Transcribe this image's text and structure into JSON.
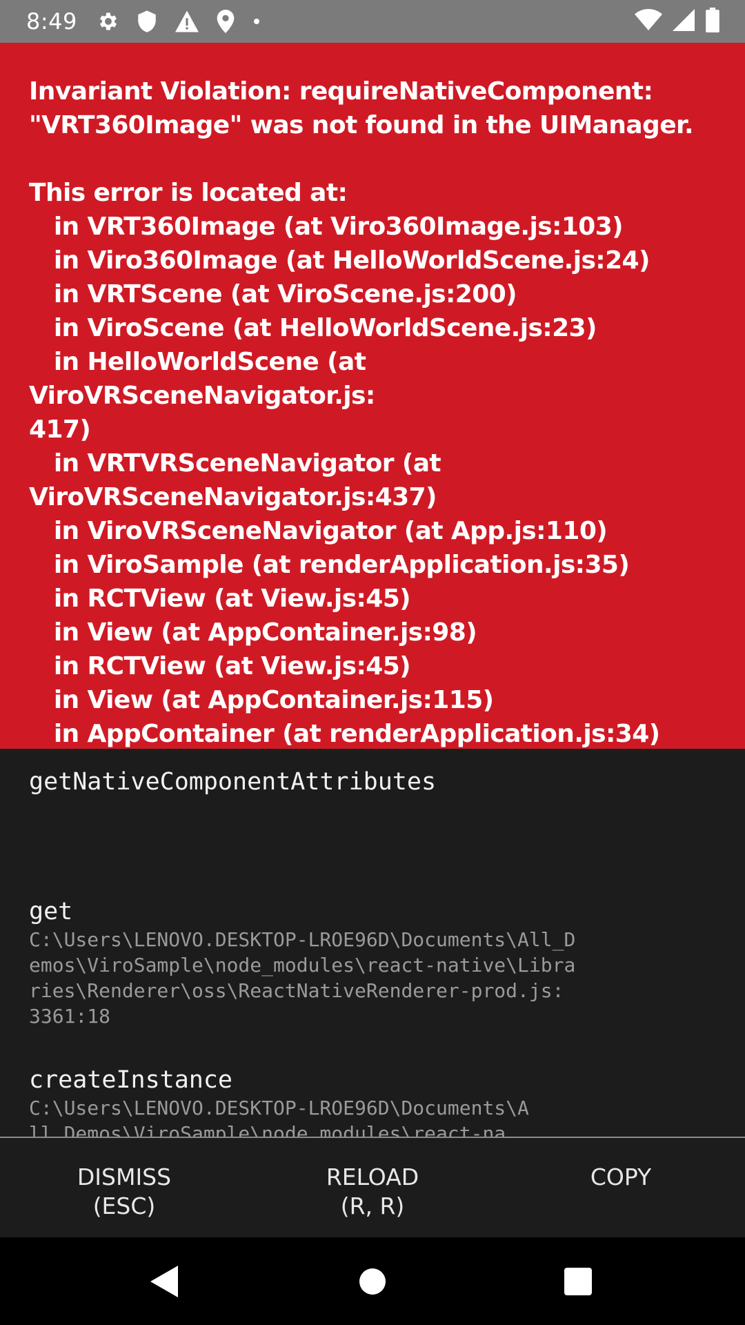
{
  "status_bar": {
    "time": "8:49",
    "icons": [
      "gear-icon",
      "shield-icon",
      "warning-icon",
      "location-pin-icon",
      "dot-icon"
    ],
    "right_icons": [
      "wifi-icon",
      "signal-icon",
      "battery-icon"
    ]
  },
  "error": {
    "title": "Invariant Violation: requireNativeComponent:\n\"VRT360Image\" was not found in the UIManager.",
    "located_header": "This error is located at:",
    "stack_lines": [
      "   in VRT360Image (at Viro360Image.js:103)",
      "   in Viro360Image (at HelloWorldScene.js:24)",
      "   in VRTScene (at ViroScene.js:200)",
      "   in ViroScene (at HelloWorldScene.js:23)",
      "   in HelloWorldScene (at ViroVRSceneNavigator.js:\n417)",
      "   in VRTVRSceneNavigator (at\nViroVRSceneNavigator.js:437)",
      "   in ViroVRSceneNavigator (at App.js:110)",
      "   in ViroSample (at renderApplication.js:35)",
      "   in RCTView (at View.js:45)",
      "   in View (at AppContainer.js:98)",
      "   in RCTView (at View.js:45)",
      "   in View (at AppContainer.js:115)",
      "   in AppContainer (at renderApplication.js:34)"
    ]
  },
  "stack_frames": [
    {
      "method": "getNativeComponentAttributes",
      "location": ""
    },
    {
      "method": "get",
      "location": "C:\\Users\\LENOVO.DESKTOP-LROE96D\\Documents\\All_D\nemos\\ViroSample\\node_modules\\react-native\\Libra\nries\\Renderer\\oss\\ReactNativeRenderer-prod.js:\n3361:18"
    },
    {
      "method": "createInstance",
      "location": "C:\\Users\\LENOVO.DESKTOP-LROE96D\\Documents\\A\nll_Demos\\ViroSample\\node_modules\\react-na\ntive\\Libraries\\Lists\\VirtualizedList.js:"
    }
  ],
  "actions": {
    "dismiss": "DISMISS\n(ESC)",
    "reload": "RELOAD\n(R, R)",
    "copy": "COPY"
  },
  "nav": [
    "back-icon",
    "home-icon",
    "recents-icon"
  ]
}
